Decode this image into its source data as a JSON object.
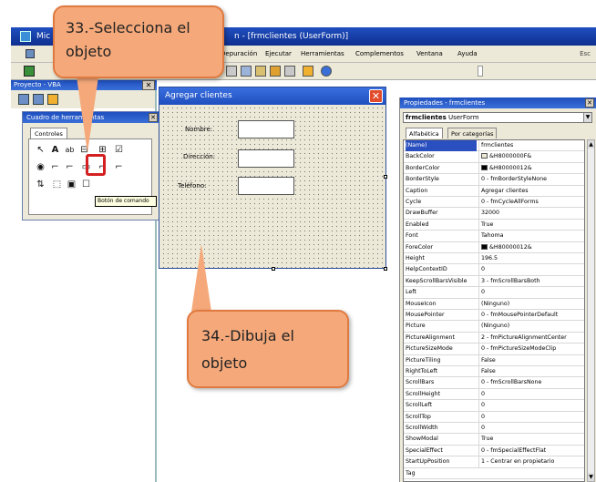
{
  "window": {
    "title_prefix": "Mic",
    "title": "n - [frmclientes (UserForm)]"
  },
  "menu": {
    "items": [
      "Depuración",
      "Ejecutar",
      "Herramientas",
      "Complementos",
      "Ventana",
      "Ayuda"
    ],
    "right_text": "Esc"
  },
  "project_pane": {
    "title": "Proyecto - VBA"
  },
  "toolbox": {
    "title": "Cuadro de herramientas",
    "tab": "Controles",
    "tooltip": "Botón de comando",
    "tools_row1": [
      "↖",
      "A",
      "ab",
      "⊟",
      "⊞",
      "☑"
    ],
    "tools_row2": [
      "◉",
      "⌐",
      "⌐",
      "▭",
      "⌐",
      "⌐"
    ],
    "tools_row3": [
      "⇅",
      "⬚",
      "▣",
      "☐"
    ]
  },
  "callouts": {
    "select_line1": "33.-Selecciona el",
    "select_line2": "objeto",
    "draw_line1": "34.-Dibuja el",
    "draw_line2": "objeto"
  },
  "form": {
    "title": "Agregar clientes",
    "close_glyph": "✕",
    "labels": [
      "Nombre:",
      "Dirección:",
      "Teléfono:"
    ]
  },
  "properties": {
    "title": "Propiedades - frmclientes",
    "object_name": "frmclientes",
    "object_type": "UserForm",
    "tab_alpha": "Alfabética",
    "tab_category": "Por categorías",
    "rows": [
      {
        "name": "(Name)",
        "value": "frmclientes"
      },
      {
        "name": "BackColor",
        "value": "&H8000000F&",
        "swatch": "#ece9d8"
      },
      {
        "name": "BorderColor",
        "value": "&H80000012&",
        "swatch": "#000000"
      },
      {
        "name": "BorderStyle",
        "value": "0 - fmBorderStyleNone"
      },
      {
        "name": "Caption",
        "value": "Agregar clientes"
      },
      {
        "name": "Cycle",
        "value": "0 - fmCycleAllForms"
      },
      {
        "name": "DrawBuffer",
        "value": "32000"
      },
      {
        "name": "Enabled",
        "value": "True"
      },
      {
        "name": "Font",
        "value": "Tahoma"
      },
      {
        "name": "ForeColor",
        "value": "&H80000012&",
        "swatch": "#000000"
      },
      {
        "name": "Height",
        "value": "196.5"
      },
      {
        "name": "HelpContextID",
        "value": "0"
      },
      {
        "name": "KeepScrollBarsVisible",
        "value": "3 - fmScrollBarsBoth"
      },
      {
        "name": "Left",
        "value": "0"
      },
      {
        "name": "MouseIcon",
        "value": "(Ninguno)"
      },
      {
        "name": "MousePointer",
        "value": "0 - fmMousePointerDefault"
      },
      {
        "name": "Picture",
        "value": "(Ninguno)"
      },
      {
        "name": "PictureAlignment",
        "value": "2 - fmPictureAlignmentCenter"
      },
      {
        "name": "PictureSizeMode",
        "value": "0 - fmPictureSizeModeClip"
      },
      {
        "name": "PictureTiling",
        "value": "False"
      },
      {
        "name": "RightToLeft",
        "value": "False"
      },
      {
        "name": "ScrollBars",
        "value": "0 - fmScrollBarsNone"
      },
      {
        "name": "ScrollHeight",
        "value": "0"
      },
      {
        "name": "ScrollLeft",
        "value": "0"
      },
      {
        "name": "ScrollTop",
        "value": "0"
      },
      {
        "name": "ScrollWidth",
        "value": "0"
      },
      {
        "name": "ShowModal",
        "value": "True"
      },
      {
        "name": "SpecialEffect",
        "value": "0 - fmSpecialEffectFlat"
      },
      {
        "name": "StartUpPosition",
        "value": "1 - Centrar en propietario"
      },
      {
        "name": "Tag",
        "value": ""
      }
    ]
  }
}
